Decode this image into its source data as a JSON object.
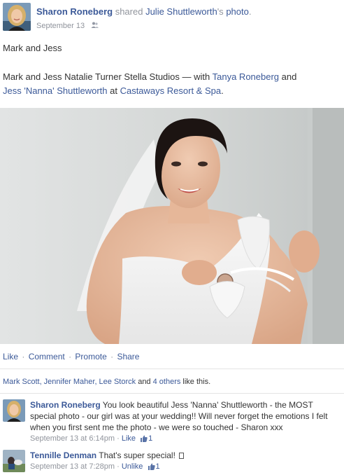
{
  "post": {
    "author": "Sharon Roneberg",
    "verb": "shared",
    "shared_owner": "Julie Shuttleworth",
    "possessive": "'s",
    "object": "photo",
    "period": ".",
    "date": "September 13",
    "privacy_icon": "friends-icon",
    "title": "Mark and Jess",
    "desc_prefix": "Mark and Jess Natalie Turner Stella Studios — with ",
    "tag1": "Tanya Roneberg",
    "and": " and",
    "tag2": "Jess 'Nanna' Shuttleworth",
    "at": " at ",
    "place": "Castaways Resort & Spa",
    "end": "."
  },
  "actions": {
    "like": "Like",
    "comment": "Comment",
    "promote": "Promote",
    "share": "Share",
    "separator": "·"
  },
  "likes": {
    "names": "Mark Scott, Jennifer Maher, Lee Storck",
    "and": " and ",
    "others": "4 others",
    "suffix": " like this."
  },
  "comments": [
    {
      "author": "Sharon Roneberg",
      "text": " You look beautiful Jess 'Nanna' Shuttleworth - the MOST special photo - our girl was at your wedding!! Will never forget the emotions I felt when you first sent me the photo - we were so touched - Sharon xxx",
      "time": "September 13 at 6:14pm",
      "sep": " · ",
      "action": "Like",
      "like_count": "1"
    },
    {
      "author": "Tennille Denman",
      "text": " That's super special! ",
      "time": "September 13 at 7:28pm",
      "sep": " · ",
      "action": "Unlike",
      "like_count": "1"
    }
  ],
  "colors": {
    "link": "#3b5998",
    "meta": "#90949c",
    "text": "#333333"
  }
}
